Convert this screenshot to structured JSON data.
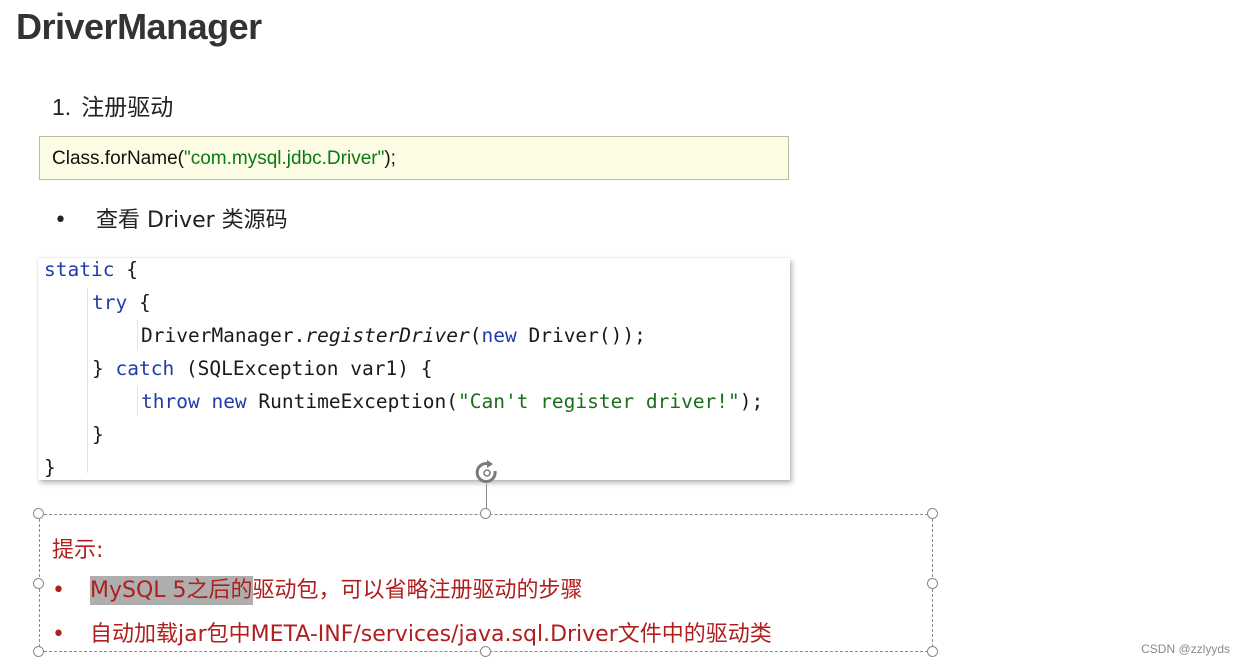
{
  "title": "DriverManager",
  "step": {
    "number": "1.",
    "text": "注册驱动"
  },
  "code_line": {
    "prefix": "Class.forName(",
    "string": "\"com.mysql.jdbc.Driver\"",
    "suffix": ");"
  },
  "bullet": {
    "dot": "•",
    "text": "查看 Driver 类源码"
  },
  "source": {
    "l1_kw": "static",
    "l1_rest": " {",
    "l2_kw": "try",
    "l2_rest": " {",
    "l3_a": "DriverManager.",
    "l3_method": "registerDriver",
    "l3_b": "(",
    "l3_kw": "new",
    "l3_c": " Driver());",
    "l4_a": "} ",
    "l4_kw": "catch",
    "l4_b": " (SQLException var1) {",
    "l5_kw1": "throw",
    "l5_sp": " ",
    "l5_kw2": "new",
    "l5_a": " RuntimeException(",
    "l5_str": "\"Can't register driver!\"",
    "l5_b": ");",
    "l6": "}",
    "l7": "}"
  },
  "tip": {
    "title": "提示:",
    "dot": "•",
    "item1_highlight": "MySQL 5之后的",
    "item1_rest": "驱动包，可以省略注册驱动的步骤",
    "item2": "自动加载jar包中META-INF/services/java.sql.Driver文件中的驱动类"
  },
  "watermark": "CSDN @zzlyyds"
}
